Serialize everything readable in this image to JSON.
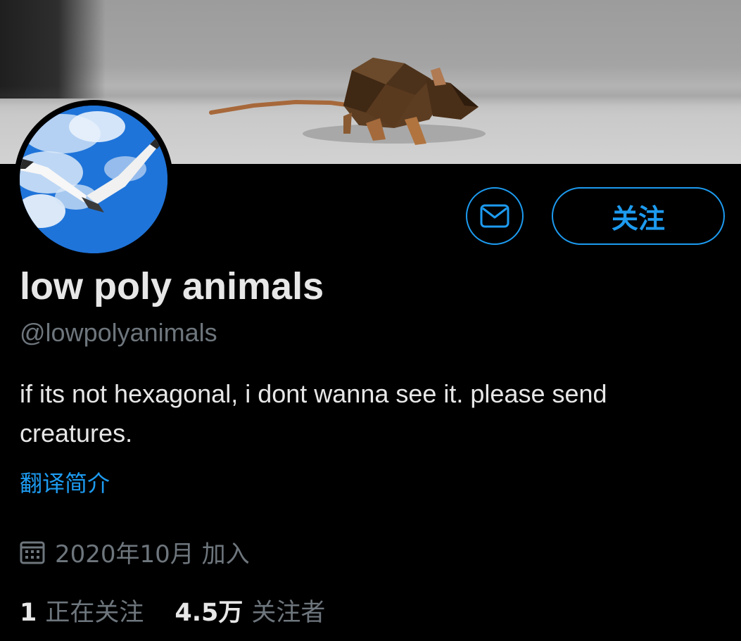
{
  "profile": {
    "display_name": "low poly animals",
    "handle": "@lowpolyanimals",
    "bio": "if its not hexagonal, i dont wanna see it.  please send creatures.",
    "translate_bio_label": "翻译简介",
    "joined": "2020年10月 加入"
  },
  "actions": {
    "message_icon": "mail-icon",
    "follow_label": "关注"
  },
  "stats": {
    "following": {
      "count": "1",
      "label": "正在关注"
    },
    "followers": {
      "count": "4.5万",
      "label": "关注者"
    }
  },
  "colors": {
    "accent": "#1d9bf0",
    "background": "#000000",
    "primary_text": "#e7e7e7",
    "secondary_text": "#6e767d"
  },
  "icons": {
    "joined": "calendar-icon"
  }
}
